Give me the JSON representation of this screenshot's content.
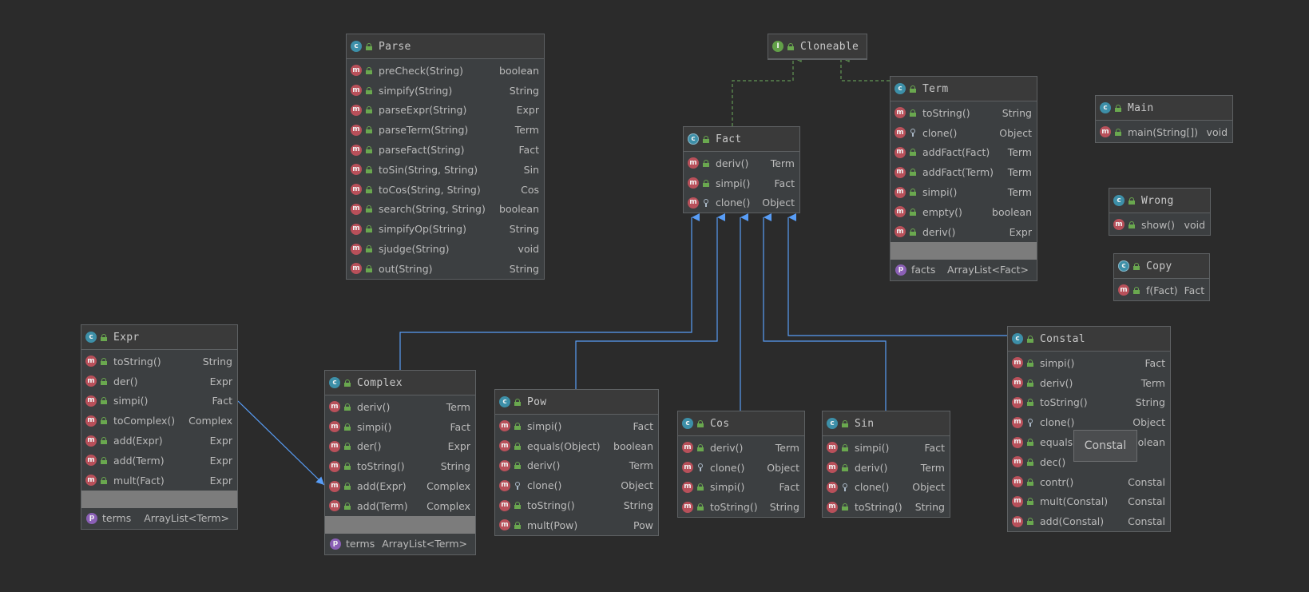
{
  "diagram": {
    "nodes": [
      {
        "id": "Parse",
        "kind": "class",
        "name": "Parse",
        "members": [
          {
            "name": "preCheck(String)",
            "type": "boolean",
            "vis": "public"
          },
          {
            "name": "simpify(String)",
            "type": "String",
            "vis": "public"
          },
          {
            "name": "parseExpr(String)",
            "type": "Expr",
            "vis": "public"
          },
          {
            "name": "parseTerm(String)",
            "type": "Term",
            "vis": "public"
          },
          {
            "name": "parseFact(String)",
            "type": "Fact",
            "vis": "public"
          },
          {
            "name": "toSin(String, String)",
            "type": "Sin",
            "vis": "public"
          },
          {
            "name": "toCos(String, String)",
            "type": "Cos",
            "vis": "public"
          },
          {
            "name": "search(String, String)",
            "type": "boolean",
            "vis": "public"
          },
          {
            "name": "simpifyOp(String)",
            "type": "String",
            "vis": "public"
          },
          {
            "name": "sjudge(String)",
            "type": "void",
            "vis": "public"
          },
          {
            "name": "out(String)",
            "type": "String",
            "vis": "public"
          }
        ],
        "fields": []
      },
      {
        "id": "Cloneable",
        "kind": "interface",
        "name": "Cloneable",
        "members": [],
        "fields": []
      },
      {
        "id": "Fact",
        "kind": "abstract",
        "name": "Fact",
        "members": [
          {
            "name": "deriv()",
            "type": "Term",
            "vis": "public"
          },
          {
            "name": "simpi()",
            "type": "Fact",
            "vis": "public"
          },
          {
            "name": "clone()",
            "type": "Object",
            "vis": "protected"
          }
        ],
        "fields": []
      },
      {
        "id": "Term",
        "kind": "class",
        "name": "Term",
        "members": [
          {
            "name": "toString()",
            "type": "String",
            "vis": "public"
          },
          {
            "name": "clone()",
            "type": "Object",
            "vis": "protected"
          },
          {
            "name": "addFact(Fact)",
            "type": "Term",
            "vis": "public"
          },
          {
            "name": "addFact(Term)",
            "type": "Term",
            "vis": "public"
          },
          {
            "name": "simpi()",
            "type": "Term",
            "vis": "public"
          },
          {
            "name": "empty()",
            "type": "boolean",
            "vis": "public"
          },
          {
            "name": "deriv()",
            "type": "Expr",
            "vis": "public"
          }
        ],
        "fields": [
          {
            "name": "facts",
            "type": "ArrayList<Fact>"
          }
        ]
      },
      {
        "id": "Main",
        "kind": "class",
        "name": "Main",
        "members": [
          {
            "name": "main(String[])",
            "type": "void",
            "vis": "public"
          }
        ],
        "fields": []
      },
      {
        "id": "Wrong",
        "kind": "class",
        "name": "Wrong",
        "members": [
          {
            "name": "show()",
            "type": "void",
            "vis": "public"
          }
        ],
        "fields": []
      },
      {
        "id": "Copy",
        "kind": "abstract",
        "name": "Copy",
        "members": [
          {
            "name": "f(Fact)",
            "type": "Fact",
            "vis": "public"
          }
        ],
        "fields": []
      },
      {
        "id": "Expr",
        "kind": "class",
        "name": "Expr",
        "members": [
          {
            "name": "toString()",
            "type": "String",
            "vis": "public"
          },
          {
            "name": "der()",
            "type": "Expr",
            "vis": "public"
          },
          {
            "name": "simpi()",
            "type": "Fact",
            "vis": "public"
          },
          {
            "name": "toComplex()",
            "type": "Complex",
            "vis": "public"
          },
          {
            "name": "add(Expr)",
            "type": "Expr",
            "vis": "public"
          },
          {
            "name": "add(Term)",
            "type": "Expr",
            "vis": "public"
          },
          {
            "name": "mult(Fact)",
            "type": "Expr",
            "vis": "public"
          }
        ],
        "fields": [
          {
            "name": "terms",
            "type": "ArrayList<Term>"
          }
        ]
      },
      {
        "id": "Complex",
        "kind": "class",
        "name": "Complex",
        "members": [
          {
            "name": "deriv()",
            "type": "Term",
            "vis": "public"
          },
          {
            "name": "simpi()",
            "type": "Fact",
            "vis": "public"
          },
          {
            "name": "der()",
            "type": "Expr",
            "vis": "public"
          },
          {
            "name": "toString()",
            "type": "String",
            "vis": "public"
          },
          {
            "name": "add(Expr)",
            "type": "Complex",
            "vis": "public"
          },
          {
            "name": "add(Term)",
            "type": "Complex",
            "vis": "public"
          }
        ],
        "fields": [
          {
            "name": "terms",
            "type": "ArrayList<Term>"
          }
        ]
      },
      {
        "id": "Pow",
        "kind": "class",
        "name": "Pow",
        "members": [
          {
            "name": "simpi()",
            "type": "Fact",
            "vis": "public"
          },
          {
            "name": "equals(Object)",
            "type": "boolean",
            "vis": "public"
          },
          {
            "name": "deriv()",
            "type": "Term",
            "vis": "public"
          },
          {
            "name": "clone()",
            "type": "Object",
            "vis": "protected"
          },
          {
            "name": "toString()",
            "type": "String",
            "vis": "public"
          },
          {
            "name": "mult(Pow)",
            "type": "Pow",
            "vis": "public"
          }
        ],
        "fields": []
      },
      {
        "id": "Cos",
        "kind": "class",
        "name": "Cos",
        "members": [
          {
            "name": "deriv()",
            "type": "Term",
            "vis": "public"
          },
          {
            "name": "clone()",
            "type": "Object",
            "vis": "protected"
          },
          {
            "name": "simpi()",
            "type": "Fact",
            "vis": "public"
          },
          {
            "name": "toString()",
            "type": "String",
            "vis": "public"
          }
        ],
        "fields": []
      },
      {
        "id": "Sin",
        "kind": "class",
        "name": "Sin",
        "members": [
          {
            "name": "simpi()",
            "type": "Fact",
            "vis": "public"
          },
          {
            "name": "deriv()",
            "type": "Term",
            "vis": "public"
          },
          {
            "name": "clone()",
            "type": "Object",
            "vis": "protected"
          },
          {
            "name": "toString()",
            "type": "String",
            "vis": "public"
          }
        ],
        "fields": []
      },
      {
        "id": "Constal",
        "kind": "class",
        "name": "Constal",
        "members": [
          {
            "name": "simpi()",
            "type": "Fact",
            "vis": "public"
          },
          {
            "name": "deriv()",
            "type": "Term",
            "vis": "public"
          },
          {
            "name": "toString()",
            "type": "String",
            "vis": "public"
          },
          {
            "name": "clone()",
            "type": "Object",
            "vis": "protected"
          },
          {
            "name": "equals(Object)",
            "type": "boolean",
            "vis": "public"
          },
          {
            "name": "dec()",
            "type": "",
            "vis": "public"
          },
          {
            "name": "contr()",
            "type": "Constal",
            "vis": "public"
          },
          {
            "name": "mult(Constal)",
            "type": "Constal",
            "vis": "public"
          },
          {
            "name": "add(Constal)",
            "type": "Constal",
            "vis": "public"
          }
        ],
        "fields": []
      }
    ],
    "edges": [
      {
        "from": "Fact",
        "to": "Cloneable",
        "kind": "implements"
      },
      {
        "from": "Term",
        "to": "Cloneable",
        "kind": "implements"
      },
      {
        "from": "Complex",
        "to": "Fact",
        "kind": "extends"
      },
      {
        "from": "Pow",
        "to": "Fact",
        "kind": "extends"
      },
      {
        "from": "Cos",
        "to": "Fact",
        "kind": "extends"
      },
      {
        "from": "Sin",
        "to": "Fact",
        "kind": "extends"
      },
      {
        "from": "Constal",
        "to": "Fact",
        "kind": "extends"
      },
      {
        "from": "Expr",
        "to": "Complex",
        "kind": "association"
      }
    ],
    "tooltip": "Constal",
    "colors": {
      "background": "#2b2b2b",
      "node": "#3c3f41",
      "implements": "#629755",
      "extends": "#589df6",
      "association": "#589df6"
    }
  }
}
